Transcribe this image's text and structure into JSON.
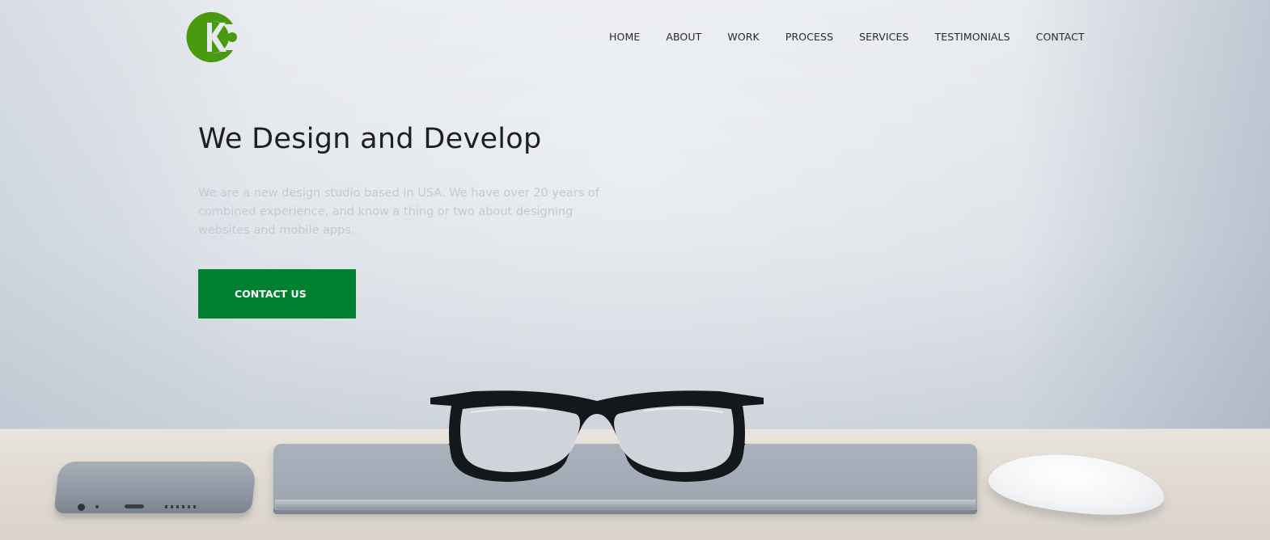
{
  "brand": {
    "logo_icon": "ck-logo-icon",
    "logo_color": "#4a9a10"
  },
  "nav": {
    "items": [
      {
        "label": "HOME"
      },
      {
        "label": "ABOUT"
      },
      {
        "label": "WORK"
      },
      {
        "label": "PROCESS"
      },
      {
        "label": "SERVICES"
      },
      {
        "label": "TESTIMONIALS"
      },
      {
        "label": "CONTACT"
      }
    ]
  },
  "hero": {
    "title": "We Design and Develop",
    "description": "We are a new design studio based in USA. We have over 20 years of combined experience, and know a thing or two about designing websites and mobile apps.",
    "cta_label": "CONTACT US",
    "cta_color": "#008030",
    "background_image": "desk-with-glasses-laptop-phone-mouse"
  }
}
